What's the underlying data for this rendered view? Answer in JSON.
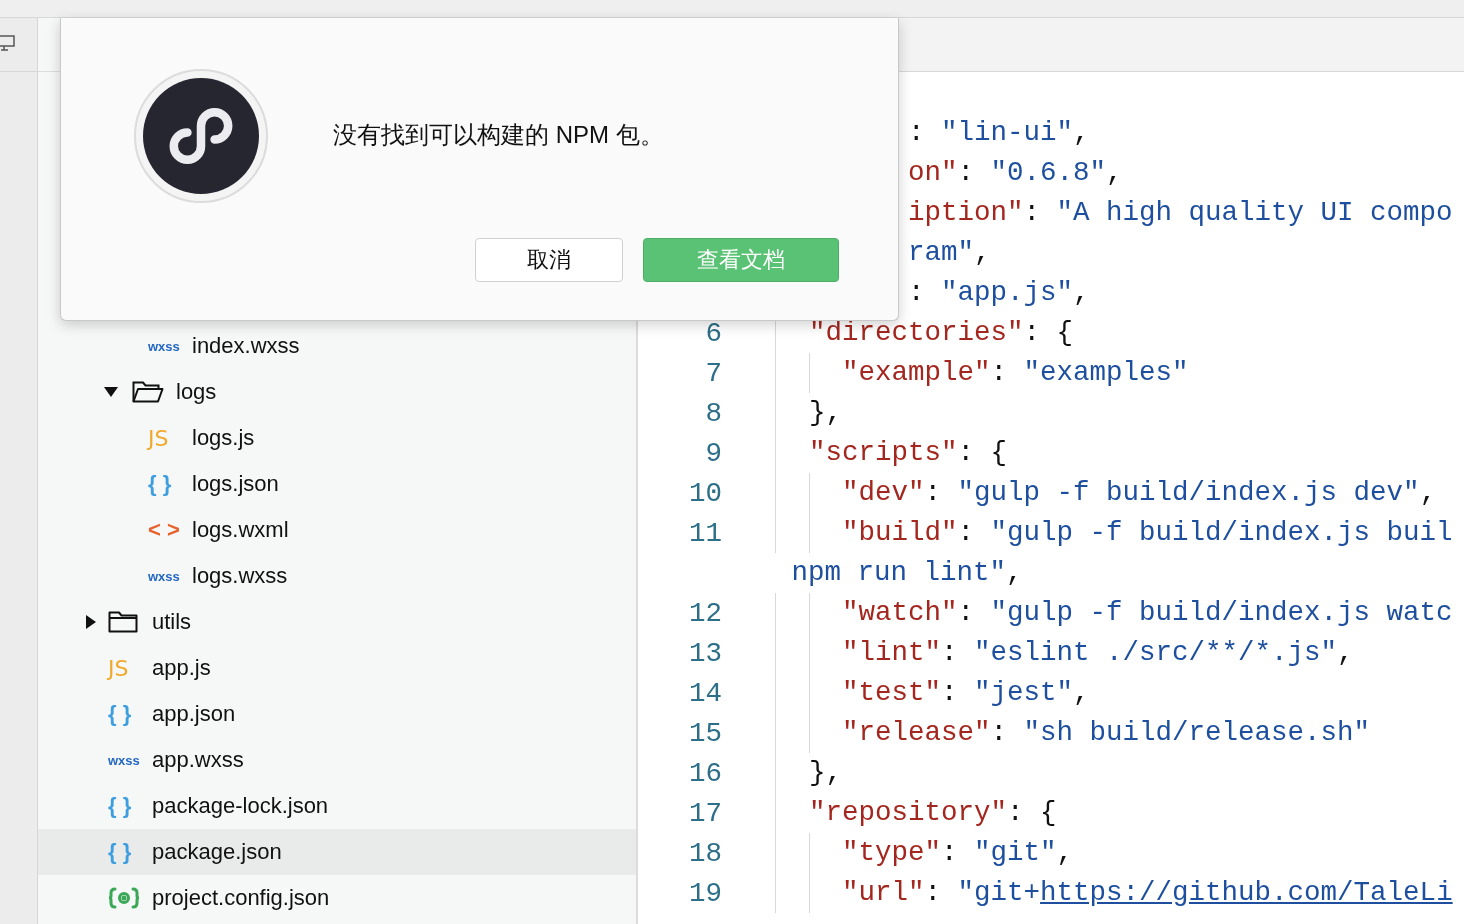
{
  "tree": [
    {
      "children": [
        {
          "children": [
            {
              "kind": "wxss",
              "icon_text": "wxss",
              "name": "index.wxss",
              "selected": false
            }
          ]
        },
        {
          "kind": "folder",
          "name": "logs",
          "expanded": true,
          "selected": false,
          "children": [
            {
              "kind": "js",
              "icon_text": "JS",
              "name": "logs.js",
              "selected": false
            },
            {
              "kind": "json",
              "icon_text": "{ }",
              "name": "logs.json",
              "selected": false
            },
            {
              "kind": "wxml",
              "icon_text": "< >",
              "name": "logs.wxml",
              "selected": false
            },
            {
              "kind": "wxss",
              "icon_text": "wxss",
              "name": "logs.wxss",
              "selected": false
            }
          ]
        }
      ]
    },
    {
      "kind": "folder",
      "name": "utils",
      "expanded": false,
      "selected": false
    },
    {
      "kind": "js",
      "icon_text": "JS",
      "name": "app.js",
      "selected": false
    },
    {
      "kind": "json",
      "icon_text": "{ }",
      "name": "app.json",
      "selected": false
    },
    {
      "kind": "wxss",
      "icon_text": "wxss",
      "name": "app.wxss",
      "selected": false
    },
    {
      "kind": "json",
      "icon_text": "{ }",
      "name": "package-lock.json",
      "selected": false
    },
    {
      "kind": "json",
      "icon_text": "{ }",
      "name": "package.json",
      "selected": true
    },
    {
      "kind": "config",
      "name": "project.config.json",
      "selected": false
    }
  ],
  "editor": {
    "lines_under_dialog": [
      [
        {
          "kind": "punct",
          "text": ": "
        },
        {
          "kind": "string",
          "text": "\"lin-ui\""
        },
        {
          "kind": "punct",
          "text": ","
        }
      ],
      [
        {
          "kind": "key",
          "text": "on\""
        },
        {
          "kind": "punct",
          "text": ": "
        },
        {
          "kind": "string",
          "text": "\"0.6.8\""
        },
        {
          "kind": "punct",
          "text": ","
        }
      ],
      [
        {
          "kind": "key",
          "text": "iption\""
        },
        {
          "kind": "punct",
          "text": ": "
        },
        {
          "kind": "string",
          "text": "\"A high quality UI compo"
        }
      ],
      [
        {
          "kind": "string",
          "text": "ram\""
        },
        {
          "kind": "punct",
          "text": ","
        }
      ],
      [
        {
          "kind": "punct",
          "text": ": "
        },
        {
          "kind": "string",
          "text": "\"app.js\""
        },
        {
          "kind": "punct",
          "text": ","
        }
      ]
    ],
    "lines": [
      {
        "number": "6",
        "tokens": [
          {
            "kind": "key",
            "text": "  \"directories\""
          },
          {
            "kind": "punct",
            "text": ": {"
          }
        ]
      },
      {
        "number": "7",
        "tokens": [
          {
            "kind": "key",
            "text": "    \"example\""
          },
          {
            "kind": "punct",
            "text": ": "
          },
          {
            "kind": "string",
            "text": "\"examples\""
          }
        ]
      },
      {
        "number": "8",
        "tokens": [
          {
            "kind": "punct",
            "text": "  },"
          }
        ]
      },
      {
        "number": "9",
        "tokens": [
          {
            "kind": "key",
            "text": "  \"scripts\""
          },
          {
            "kind": "punct",
            "text": ": {"
          }
        ]
      },
      {
        "number": "10",
        "tokens": [
          {
            "kind": "key",
            "text": "    \"dev\""
          },
          {
            "kind": "punct",
            "text": ": "
          },
          {
            "kind": "string",
            "text": "\"gulp -f build/index.js dev\""
          },
          {
            "kind": "punct",
            "text": ","
          }
        ]
      },
      {
        "number": "11",
        "tokens": [
          {
            "kind": "key",
            "text": "    \"build\""
          },
          {
            "kind": "punct",
            "text": ": "
          },
          {
            "kind": "string",
            "text": "\"gulp -f build/index.js buil"
          }
        ]
      },
      {
        "tokens": [
          {
            "kind": "string",
            "text": " npm run lint\""
          },
          {
            "kind": "punct",
            "text": ","
          }
        ]
      },
      {
        "number": "12",
        "tokens": [
          {
            "kind": "key",
            "text": "    \"watch\""
          },
          {
            "kind": "punct",
            "text": ": "
          },
          {
            "kind": "string",
            "text": "\"gulp -f build/index.js watc"
          }
        ]
      },
      {
        "number": "13",
        "tokens": [
          {
            "kind": "key",
            "text": "    \"lint\""
          },
          {
            "kind": "punct",
            "text": ": "
          },
          {
            "kind": "string",
            "text": "\"eslint ./src/**/*.js\""
          },
          {
            "kind": "punct",
            "text": ","
          }
        ]
      },
      {
        "number": "14",
        "tokens": [
          {
            "kind": "key",
            "text": "    \"test\""
          },
          {
            "kind": "punct",
            "text": ": "
          },
          {
            "kind": "string",
            "text": "\"jest\""
          },
          {
            "kind": "punct",
            "text": ","
          }
        ]
      },
      {
        "number": "15",
        "tokens": [
          {
            "kind": "key",
            "text": "    \"release\""
          },
          {
            "kind": "punct",
            "text": ": "
          },
          {
            "kind": "string",
            "text": "\"sh build/release.sh\""
          }
        ]
      },
      {
        "number": "16",
        "tokens": [
          {
            "kind": "punct",
            "text": "  },"
          }
        ]
      },
      {
        "number": "17",
        "tokens": [
          {
            "kind": "key",
            "text": "  \"repository\""
          },
          {
            "kind": "punct",
            "text": ": {"
          }
        ]
      },
      {
        "number": "18",
        "tokens": [
          {
            "kind": "key",
            "text": "    \"type\""
          },
          {
            "kind": "punct",
            "text": ": "
          },
          {
            "kind": "string",
            "text": "\"git\""
          },
          {
            "kind": "punct",
            "text": ","
          }
        ]
      },
      {
        "number": "19",
        "tokens": [
          {
            "kind": "key",
            "text": "    \"url\""
          },
          {
            "kind": "punct",
            "text": ": "
          },
          {
            "kind": "string",
            "text": "\"git+"
          },
          {
            "kind": "link",
            "text": "https://github.com/TaleLi"
          }
        ]
      }
    ]
  },
  "dialog": {
    "message": "没有找到可以构建的 NPM 包。",
    "buttons": [
      {
        "label": "取消",
        "kind": "secondary"
      },
      {
        "label": "查看文档",
        "kind": "primary"
      }
    ]
  }
}
